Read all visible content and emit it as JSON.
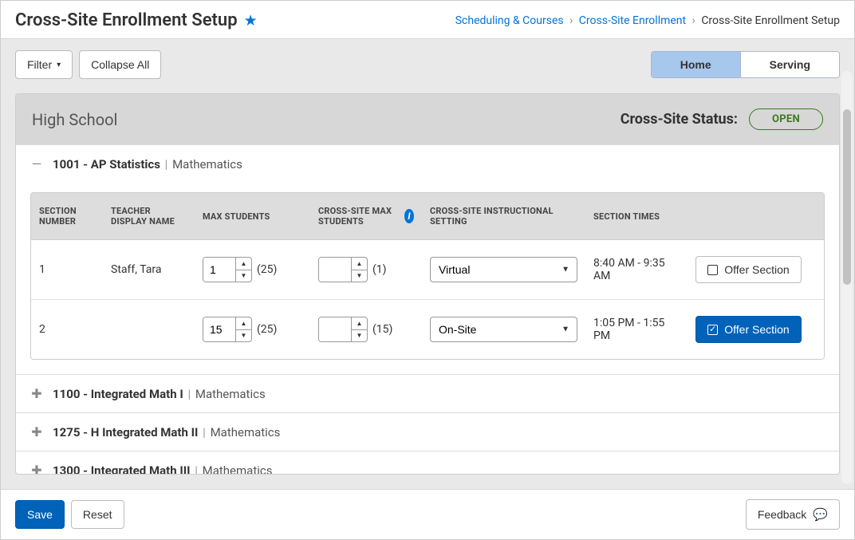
{
  "header": {
    "title": "Cross-Site Enrollment Setup",
    "breadcrumb": {
      "items": [
        "Scheduling & Courses",
        "Cross-Site Enrollment",
        "Cross-Site Enrollment Setup"
      ]
    }
  },
  "toolbar": {
    "filter_label": "Filter",
    "collapse_label": "Collapse All",
    "tabs": {
      "home": "Home",
      "serving": "Serving"
    }
  },
  "school": {
    "name": "High School",
    "status_label": "Cross-Site Status:",
    "status_value": "OPEN"
  },
  "courses": [
    {
      "code": "1001 - AP Statistics",
      "department": "Mathematics",
      "expanded": true,
      "sections": [
        {
          "number": "1",
          "teacher": "Staff, Tara",
          "max_students": "1",
          "max_students_cap": "(25)",
          "cs_max_students": "",
          "cs_max_students_cap": "(1)",
          "setting": "Virtual",
          "times": "8:40 AM - 9:35 AM",
          "offered": false
        },
        {
          "number": "2",
          "teacher": "",
          "max_students": "15",
          "max_students_cap": "(25)",
          "cs_max_students": "",
          "cs_max_students_cap": "(15)",
          "setting": "On-Site",
          "times": "1:05 PM - 1:55 PM",
          "offered": true
        }
      ]
    },
    {
      "code": "1100 - Integrated Math I",
      "department": "Mathematics",
      "expanded": false
    },
    {
      "code": "1275 - H Integrated Math II",
      "department": "Mathematics",
      "expanded": false
    },
    {
      "code": "1300 - Integrated Math III",
      "department": "Mathematics",
      "expanded": false
    }
  ],
  "columns": {
    "section_number": "Section Number",
    "teacher": "Teacher Display Name",
    "max": "Max Students",
    "cs_max": "Cross-Site Max Students",
    "setting": "Cross-Site Instructional Setting",
    "times": "Section Times"
  },
  "setting_options": [
    "Virtual",
    "On-Site"
  ],
  "offer_label": "Offer Section",
  "footer": {
    "save": "Save",
    "reset": "Reset",
    "feedback": "Feedback"
  }
}
